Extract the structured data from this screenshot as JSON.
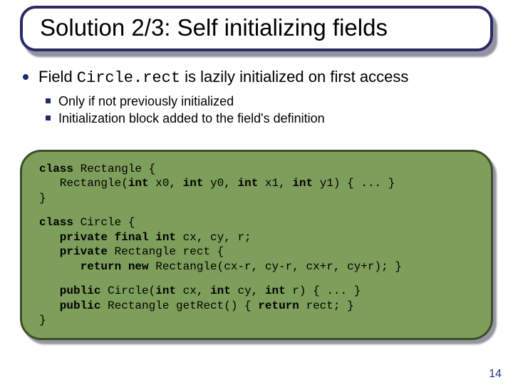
{
  "title": "Solution 2/3: Self initializing fields",
  "bullet": {
    "pre": "Field ",
    "code": "Circle.rect",
    "post": " is lazily initialized on first access",
    "subs": [
      "Only if not previously initialized",
      "Initialization block added to the field's definition"
    ]
  },
  "code": {
    "l1a": "class",
    "l1b": " Rectangle {",
    "l2a": "   Rectangle(",
    "l2b": "int",
    "l2c": " x0, ",
    "l2d": "int",
    "l2e": " y0, ",
    "l2f": "int",
    "l2g": " x1, ",
    "l2h": "int",
    "l2i": " y1) { ... }",
    "l3": "}",
    "l4a": "class",
    "l4b": " Circle {",
    "l5a": "   private final int",
    "l5b": " cx, cy, r;",
    "l6a": "   private",
    "l6b": " Rectangle rect {",
    "l7a": "      return new",
    "l7b": " Rectangle(cx-r, cy-r, cx+r, cy+r); }",
    "l8a": "   public",
    "l8b": " Circle(",
    "l8c": "int",
    "l8d": " cx, ",
    "l8e": "int",
    "l8f": " cy, ",
    "l8g": "int",
    "l8h": " r) { ... }",
    "l9a": "   public",
    "l9b": " Rectangle getRect() { ",
    "l9c": "return",
    "l9d": " rect; }",
    "l10": "}"
  },
  "page_number": "14"
}
